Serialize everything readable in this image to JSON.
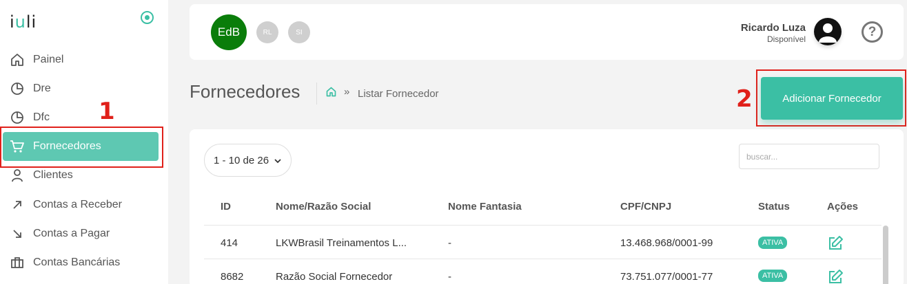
{
  "app": {
    "logo": "iuli"
  },
  "sidebar": {
    "items": [
      {
        "label": "Painel",
        "icon": "home-icon"
      },
      {
        "label": "Dre",
        "icon": "pie-chart-icon"
      },
      {
        "label": "Dfc",
        "icon": "pie-chart-icon"
      },
      {
        "label": "Fornecedores",
        "icon": "cart-icon",
        "active": true
      },
      {
        "label": "Clientes",
        "icon": "user-icon"
      },
      {
        "label": "Contas a Receber",
        "icon": "arrow-up-left-icon"
      },
      {
        "label": "Contas a Pagar",
        "icon": "arrow-down-right-icon"
      },
      {
        "label": "Contas Bancárias",
        "icon": "briefcase-icon"
      }
    ]
  },
  "annotations": {
    "one": "1",
    "two": "2"
  },
  "header": {
    "company_avatars": [
      "EdB",
      "RL",
      "SI"
    ],
    "user_name": "Ricardo Luza",
    "user_status": "Disponível",
    "help": "?"
  },
  "page": {
    "title": "Fornecedores",
    "breadcrumb_sep": "»",
    "breadcrumb": "Listar Fornecedor",
    "add_button": "Adicionar Fornecedor"
  },
  "table": {
    "pager": "1 - 10 de 26",
    "search_placeholder": "buscar...",
    "columns": [
      "ID",
      "Nome/Razão Social",
      "Nome Fantasia",
      "CPF/CNPJ",
      "Status",
      "Ações"
    ],
    "rows": [
      {
        "id": "414",
        "nome": "LKWBrasil Treinamentos L...",
        "fantasia": "-",
        "cnpj": "13.468.968/0001-99",
        "status": "ATIVA"
      },
      {
        "id": "8682",
        "nome": "Razão Social Fornecedor",
        "fantasia": "-",
        "cnpj": "73.751.077/0001-77",
        "status": "ATIVA"
      }
    ]
  },
  "colors": {
    "accent": "#3bbfa4",
    "active_nav": "#5ec8b2",
    "annotation": "#e0201a",
    "company_avatar": "#0a7d0a"
  }
}
